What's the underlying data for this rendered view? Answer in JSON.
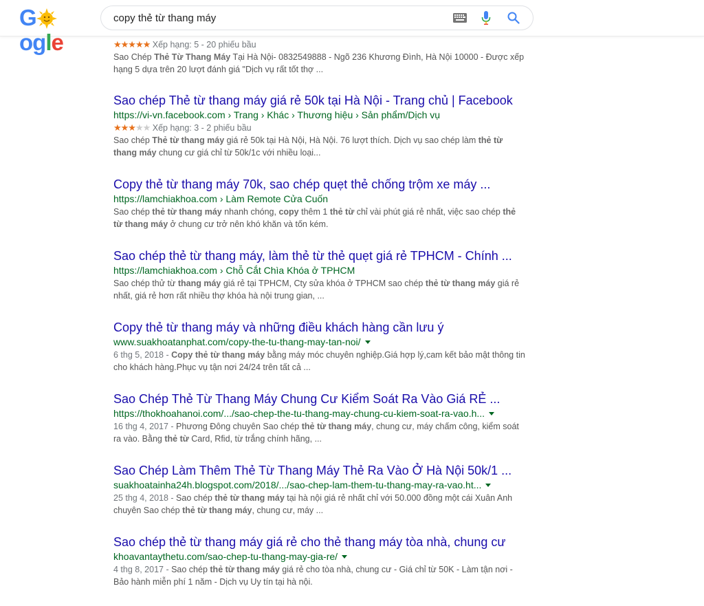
{
  "search": {
    "query": "copy thẻ từ thang máy"
  },
  "colors": {
    "link": "#1a0dab",
    "url": "#006621",
    "snippet": "#545454",
    "star": "#e7711b"
  },
  "results": [
    {
      "title": "",
      "url": "",
      "rating": {
        "stars": 5,
        "text": "Xếp hạng: 5 - 20 phiếu bầu"
      },
      "snippet_html": "Sao Chép <b>Thẻ Từ Thang Máy</b> Tại Hà Nội- 0832549888 - Ngõ 236 Khương Đình, Hà Nội 10000 - Được xếp hạng 5 dựa trên 20 lượt đánh giá \"Dịch vụ rất tốt thợ ..."
    },
    {
      "title": "Sao chép Thẻ từ thang máy giá rẻ 50k tại Hà Nội - Trang chủ | Facebook",
      "url": "https://vi-vn.facebook.com › Trang › Khác › Thương hiệu › Sản phẩm/Dịch vụ",
      "rating": {
        "stars": 3,
        "text": "Xếp hạng: 3 - 2 phiếu bầu"
      },
      "snippet_html": "Sao chép <b>Thẻ từ thang máy</b> giá rẻ 50k tại Hà Nội, Hà Nội. 76 lượt thích. Dịch vụ sao chép làm <b>thẻ từ thang máy</b> chung cư giá chỉ từ 50k/1c với nhiều loại..."
    },
    {
      "title": "Copy thẻ từ thang máy 70k, sao chép quẹt thẻ chống trộm xe máy ...",
      "url": "https://lamchiakhoa.com › Làm Remote Cửa Cuốn",
      "snippet_html": "Sao chép <b>thẻ từ thang máy</b> nhanh chóng, <b>copy</b> thêm 1 <b>thẻ từ</b> chỉ vài phút giá rẻ nhất, việc sao chép <b>thẻ từ thang máy</b> ở chung cư trở nên khó khăn và tốn kém."
    },
    {
      "title": "Sao chép thẻ từ thang máy, làm thẻ từ thẻ quẹt giá rẻ TPHCM - Chính ...",
      "url": "https://lamchiakhoa.com › Chỗ Cắt Chìa Khóa ở TPHCM",
      "snippet_html": "Sao chép thử từ <b>thang máy</b> giá rẻ tại TPHCM, Cty sửa khóa ở TPHCM sao chép <b>thẻ từ thang máy</b> giá rẻ nhất, giá rẻ hơn rất nhiều thợ khóa hà nội trung gian, ..."
    },
    {
      "title": "Copy thẻ từ thang máy và những điều khách hàng cần lưu ý",
      "url": "www.suakhoatanphat.com/copy-the-tu-thang-may-tan-noi/",
      "caret": true,
      "snippet_html": "<span class=\"r-date\">6 thg 5, 2018 - </span><b>Copy thẻ từ thang máy</b> bằng máy móc chuyên nghiệp.Giá hợp lý,cam kết bảo mật thông tin cho khách hàng.Phục vụ tận nơi 24/24 trên tất cả ..."
    },
    {
      "title": "Sao Chép Thẻ Từ Thang Máy Chung Cư Kiểm Soát Ra Vào Giá RẺ ...",
      "url": "https://thokhoahanoi.com/.../sao-chep-the-tu-thang-may-chung-cu-kiem-soat-ra-vao.h...",
      "caret": true,
      "snippet_html": "<span class=\"r-date\">16 thg 4, 2017 - </span>Phương Đông chuyên Sao chép <b>thẻ từ thang máy</b>, chung cư, máy chấm công, kiểm soát ra vào. Bằng <b>thẻ từ</b> Card, Rfid, từ trắng chính hãng, ..."
    },
    {
      "title": "Sao Chép Làm Thêm Thẻ Từ Thang Máy Thẻ Ra Vào Ở Hà Nội 50k/1 ...",
      "url": "suakhoatainha24h.blogspot.com/2018/.../sao-chep-lam-them-tu-thang-may-ra-vao.ht...",
      "caret": true,
      "snippet_html": "<span class=\"r-date\">25 thg 4, 2018 - </span>Sao chép <b>thẻ từ thang máy</b> tại hà nội giá rẻ nhất chỉ với 50.000 đồng một cái Xuân Anh chuyên Sao chép <b>thẻ từ thang máy</b>, chung cư, máy ..."
    },
    {
      "title": "Sao chép thẻ từ thang máy giá rẻ cho thẻ thang máy tòa nhà, chung cư",
      "url": "khoavantaythetu.com/sao-chep-tu-thang-may-gia-re/",
      "caret": true,
      "snippet_html": "<span class=\"r-date\">4 thg 8, 2017 - </span>Sao chép <b>thẻ từ thang máy</b> giá rẻ cho tòa nhà, chung cư - Giá chỉ từ 50K - Làm tận nơi - Bảo hành miễn phí 1 năm - Dịch vụ Uy tín tại hà nội."
    }
  ]
}
